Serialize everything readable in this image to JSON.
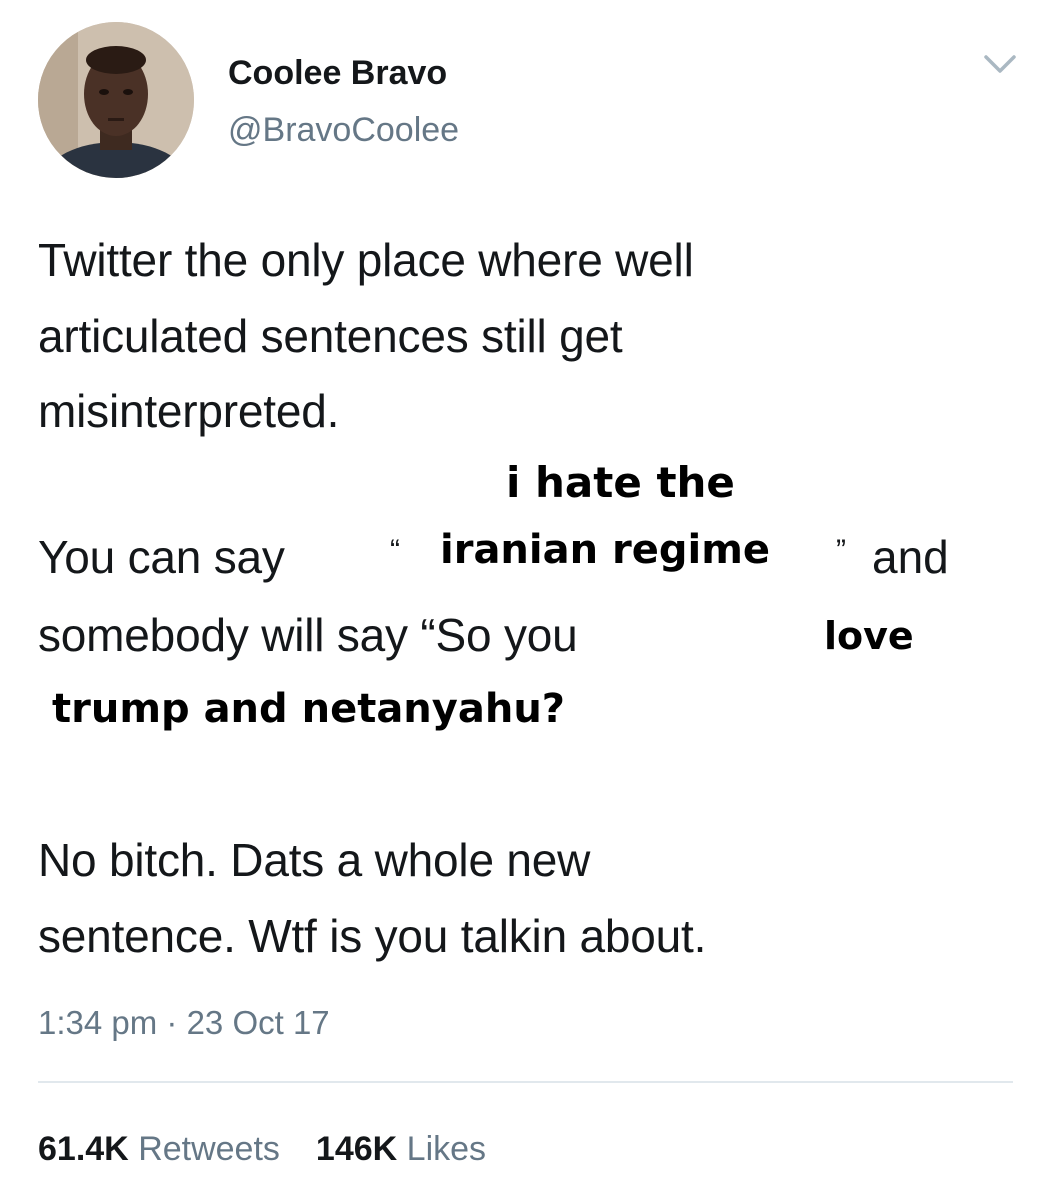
{
  "user": {
    "display_name": "Coolee Bravo",
    "handle": "@BravoCoolee"
  },
  "tweet": {
    "line1": "Twitter the only place where well",
    "line2": "articulated sentences still get",
    "line3": "misinterpreted.",
    "line4_start": "You can say",
    "quote_open": "“",
    "quote_close": "”",
    "line4_end": "and",
    "line5": "somebody will say “So you",
    "line6": "No bitch. Dats a whole new",
    "line7": "sentence. Wtf is you talkin about."
  },
  "overlay_text": {
    "over1": "i hate the",
    "over2": "iranian regime",
    "over3": "love",
    "over4": "trump and netanyahu?"
  },
  "meta": {
    "timestamp": "1:34 pm · 23 Oct 17"
  },
  "stats": {
    "retweets_count": "61.4K",
    "retweets_label": "Retweets",
    "likes_count": "146K",
    "likes_label": "Likes"
  },
  "icons": {
    "menu": "chevron-down-icon",
    "avatar": "profile-photo"
  }
}
